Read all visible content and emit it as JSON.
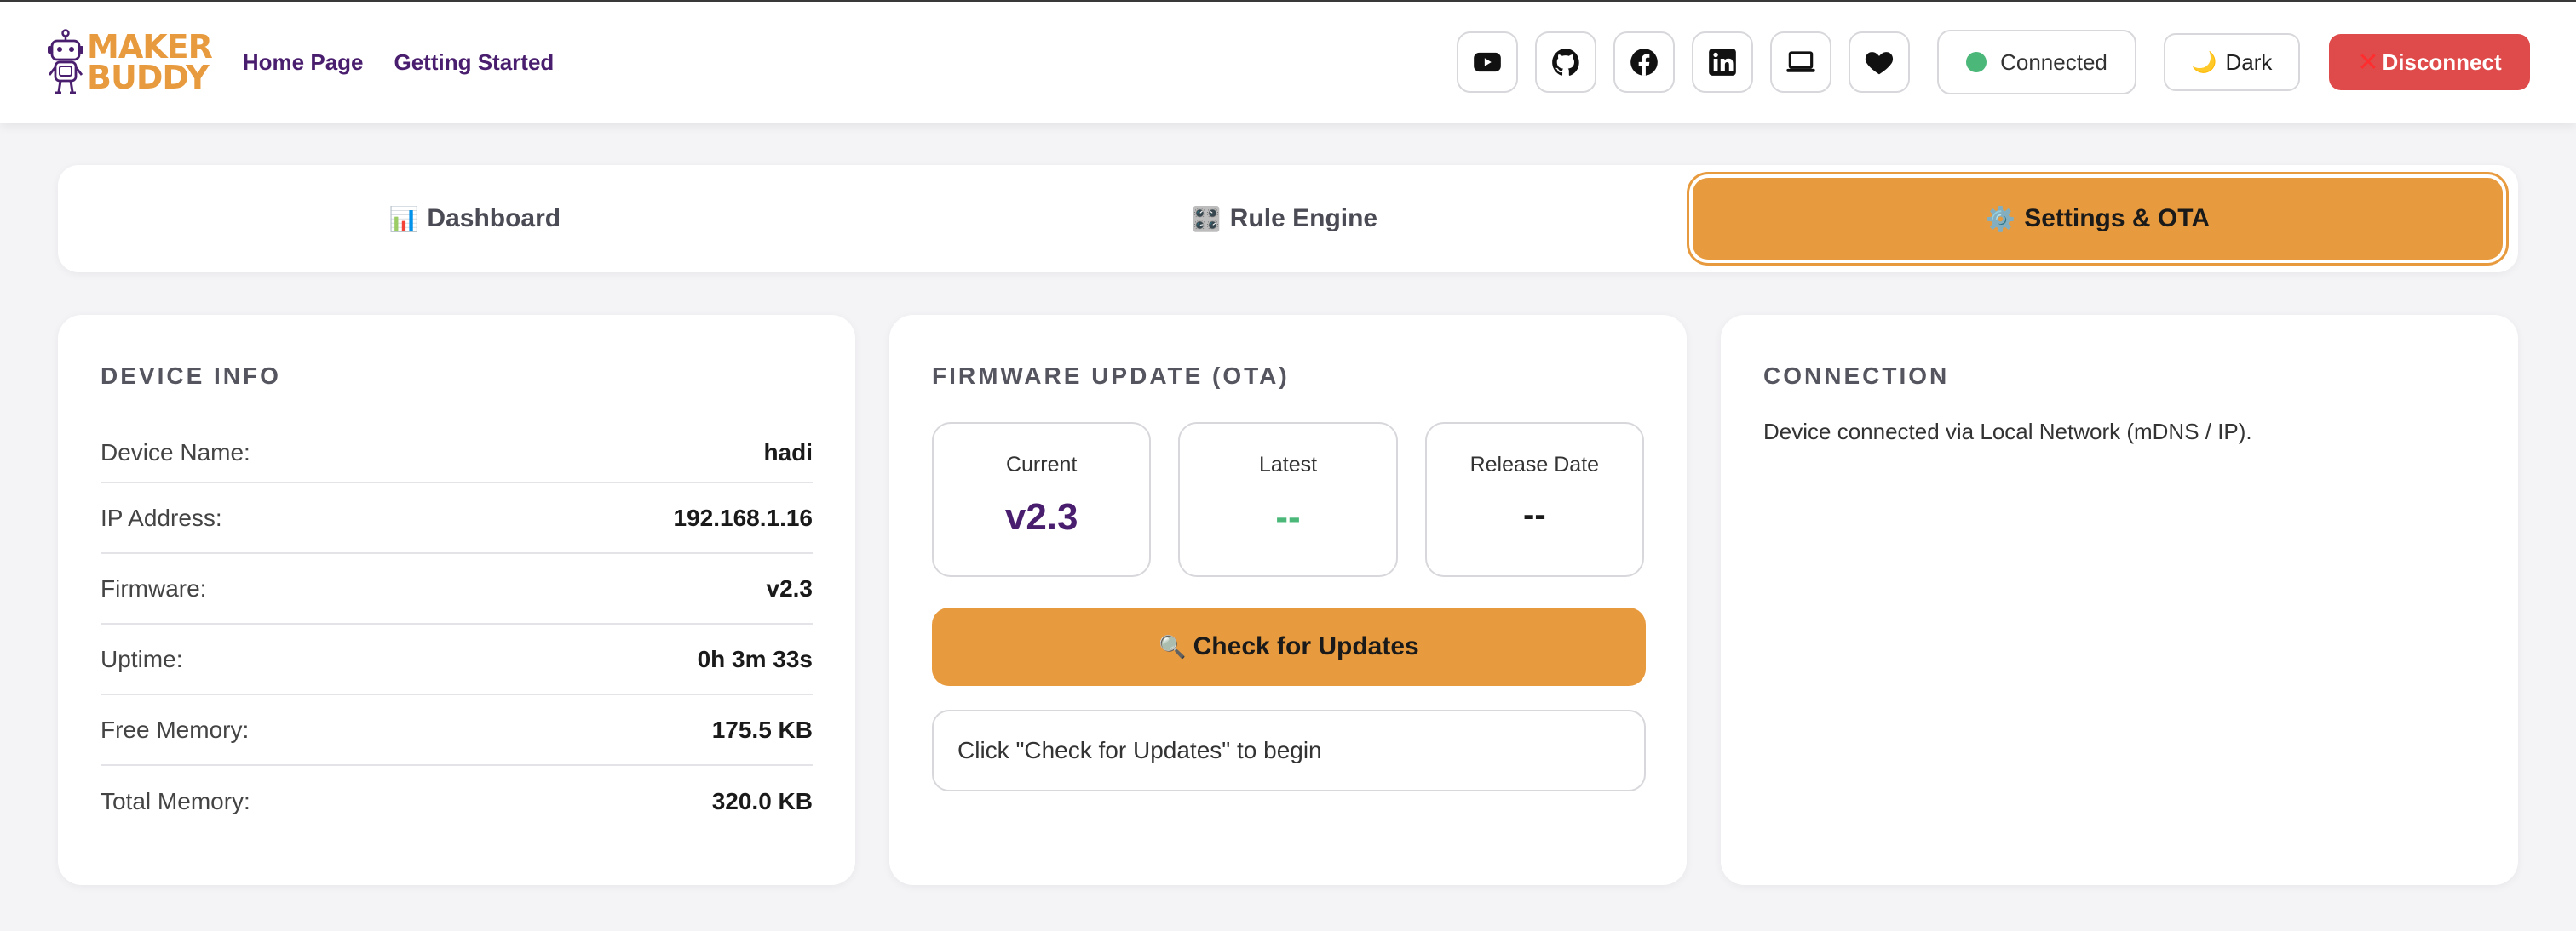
{
  "brand": {
    "line1": "MAKER",
    "line2": "BUDDY"
  },
  "nav": {
    "home": "Home Page",
    "getting_started": "Getting Started"
  },
  "header": {
    "icons": [
      "youtube-icon",
      "github-icon",
      "facebook-icon",
      "linkedin-icon",
      "laptop-icon",
      "heart-icon"
    ],
    "status_label": "Connected",
    "theme_label": "Dark",
    "disconnect_label": "Disconnect"
  },
  "tabs": [
    {
      "emoji": "📊",
      "label": "Dashboard"
    },
    {
      "emoji": "🎛️",
      "label": "Rule Engine"
    },
    {
      "emoji": "⚙️",
      "label": "Settings & OTA"
    }
  ],
  "device_info": {
    "title": "DEVICE INFO",
    "rows": [
      {
        "label": "Device Name:",
        "value": "hadi"
      },
      {
        "label": "IP Address:",
        "value": "192.168.1.16"
      },
      {
        "label": "Firmware:",
        "value": "v2.3"
      },
      {
        "label": "Uptime:",
        "value": "0h 3m 33s"
      },
      {
        "label": "Free Memory:",
        "value": "175.5 KB"
      },
      {
        "label": "Total Memory:",
        "value": "320.0 KB"
      }
    ]
  },
  "ota": {
    "title": "FIRMWARE UPDATE (OTA)",
    "current_label": "Current",
    "current_value": "v2.3",
    "latest_label": "Latest",
    "latest_value": "--",
    "release_label": "Release Date",
    "release_value": "--",
    "check_emoji": "🔍",
    "check_label": "Check for Updates",
    "status_text": "Click \"Check for Updates\" to begin"
  },
  "connection": {
    "title": "CONNECTION",
    "text": "Device connected via Local Network (mDNS / IP)."
  },
  "colors": {
    "accent": "#e89b3e",
    "brand_purple": "#4a1e6e",
    "danger": "#df4a4a",
    "success": "#4bb87a"
  }
}
